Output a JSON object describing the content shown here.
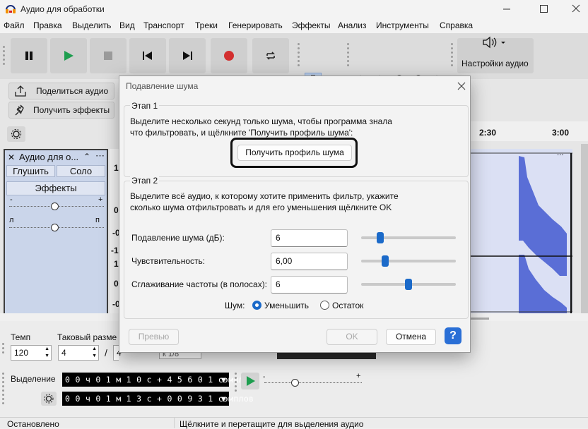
{
  "window": {
    "title": "Аудио для обработки",
    "min_icon": "minimize-icon",
    "max_icon": "maximize-icon",
    "close_icon": "close-icon"
  },
  "menu": [
    "Файл",
    "Правка",
    "Выделить",
    "Вид",
    "Транспорт",
    "Треки",
    "Генерировать",
    "Эффекты",
    "Анализ",
    "Инструменты",
    "Справка"
  ],
  "toolbar": {
    "audio_setup_label": "Настройки аудио"
  },
  "share": {
    "share_label": "Поделиться аудио",
    "effects_label": "Получить эффекты"
  },
  "ruler": {
    "ticks": [
      "2:30",
      "3:00"
    ]
  },
  "track": {
    "name": "Аудио для о...",
    "mute": "Глушить",
    "solo": "Соло",
    "effects": "Эффекты",
    "pan_left": "л",
    "pan_right": "п",
    "gain_minus": "-",
    "gain_plus": "+"
  },
  "vruler": [
    "1",
    "0",
    "-0",
    "-1",
    "1",
    "0",
    "-0"
  ],
  "bottom": {
    "tempo_label": "Темп",
    "tempo_value": "120",
    "timesig_label": "Таковый разме",
    "timesig_num": "4",
    "timesig_sep": "/",
    "timesig_den": "4",
    "snap_value": "к 1/8",
    "selection_label": "Выделение",
    "sel_start": "0 0 ч 0 1 м 1 0 с + 4 5 6 0 1 сэмплов",
    "sel_end": "0 0 ч 0 1 м 1 3 с + 0 0 9 3 1 сэмплов"
  },
  "status": {
    "left": "Остановлено",
    "right": "Щёлкните и перетащите для выделения аудио"
  },
  "dialog": {
    "title": "Подавление шума",
    "step1_title": "Этап 1",
    "step1_text1": "Выделите несколько секунд только шума, чтобы программа знала",
    "step1_text2": "что фильтровать, и щёлкните 'Получить профиль шума':",
    "get_profile": "Получить профиль шума",
    "step2_title": "Этап 2",
    "step2_text1": "Выделите всё аудио, к которому хотите применить фильтр, укажите",
    "step2_text2": "сколько шума отфильтровать и для его уменьшения щёлкните OK",
    "params": [
      {
        "label": "Подавление шума (дБ):",
        "value": "6",
        "level": 0.2
      },
      {
        "label": "Чувствительность:",
        "value": "6,00",
        "level": 0.25
      },
      {
        "label": "Сглаживание частоты (в полосах):",
        "value": "6",
        "level": 0.5
      }
    ],
    "noise_label": "Шум:",
    "reduce_label": "Уменьшить",
    "residue_label": "Остаток",
    "preview": "Превью",
    "ok": "OK",
    "cancel": "Отмена",
    "help": "?"
  },
  "colors": {
    "accent": "#1b6ac9",
    "wave": "#5a6ed6",
    "record": "#d32f2f",
    "play": "#1e9e4f"
  }
}
